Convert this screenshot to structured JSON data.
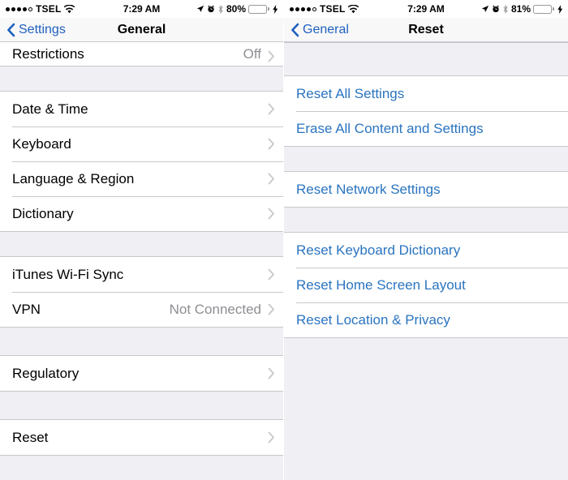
{
  "left": {
    "status_bar": {
      "signal_dots_filled": 4,
      "signal_dots_total": 5,
      "carrier": "TSEL",
      "wifi_icon": "wifi-icon",
      "time": "7:29 AM",
      "location_icon": "location-arrow-icon",
      "alarm_icon": "alarm-clock-icon",
      "bluetooth_icon": "bluetooth-icon",
      "battery_percent": "80%",
      "battery_level": 80,
      "battery_color": "#ffcc00",
      "charging_icon": "lightning-bolt-icon"
    },
    "nav": {
      "back_icon": "chevron-left-icon",
      "back_label": "Settings",
      "title": "General"
    },
    "sections": [
      {
        "partial": true,
        "rows": [
          {
            "label": "Restrictions",
            "value": "Off",
            "chevron": "chevron-right-icon"
          }
        ]
      },
      {
        "rows": [
          {
            "label": "Date & Time",
            "value": "",
            "chevron": "chevron-right-icon"
          },
          {
            "label": "Keyboard",
            "value": "",
            "chevron": "chevron-right-icon"
          },
          {
            "label": "Language & Region",
            "value": "",
            "chevron": "chevron-right-icon"
          },
          {
            "label": "Dictionary",
            "value": "",
            "chevron": "chevron-right-icon"
          }
        ]
      },
      {
        "rows": [
          {
            "label": "iTunes Wi-Fi Sync",
            "value": "",
            "chevron": "chevron-right-icon"
          },
          {
            "label": "VPN",
            "value": "Not Connected",
            "chevron": "chevron-right-icon"
          }
        ]
      },
      {
        "rows": [
          {
            "label": "Regulatory",
            "value": "",
            "chevron": "chevron-right-icon"
          }
        ]
      },
      {
        "rows": [
          {
            "label": "Reset",
            "value": "",
            "chevron": "chevron-right-icon"
          }
        ]
      }
    ]
  },
  "right": {
    "status_bar": {
      "signal_dots_filled": 4,
      "signal_dots_total": 5,
      "carrier": "TSEL",
      "wifi_icon": "wifi-icon",
      "time": "7:29 AM",
      "location_icon": "location-arrow-icon",
      "alarm_icon": "alarm-clock-icon",
      "bluetooth_icon": "bluetooth-icon",
      "battery_percent": "81%",
      "battery_level": 81,
      "battery_color": "#ffcc00",
      "charging_icon": "lightning-bolt-icon"
    },
    "nav": {
      "back_icon": "chevron-left-icon",
      "back_label": "General",
      "title": "Reset"
    },
    "sections": [
      {
        "rows": [
          {
            "label": "Reset All Settings",
            "link": true
          },
          {
            "label": "Erase All Content and Settings",
            "link": true
          }
        ]
      },
      {
        "rows": [
          {
            "label": "Reset Network Settings",
            "link": true
          }
        ]
      },
      {
        "rows": [
          {
            "label": "Reset Keyboard Dictionary",
            "link": true
          },
          {
            "label": "Reset Home Screen Layout",
            "link": true
          },
          {
            "label": "Reset Location & Privacy",
            "link": true
          }
        ]
      }
    ]
  },
  "colors": {
    "accent_blue": "#2a74c0",
    "nav_blue": "#1f5fbf",
    "group_bg": "#efeff4",
    "separator": "#c8c7cc",
    "secondary_text": "#8e8e93",
    "battery_yellow": "#ffcc00"
  }
}
